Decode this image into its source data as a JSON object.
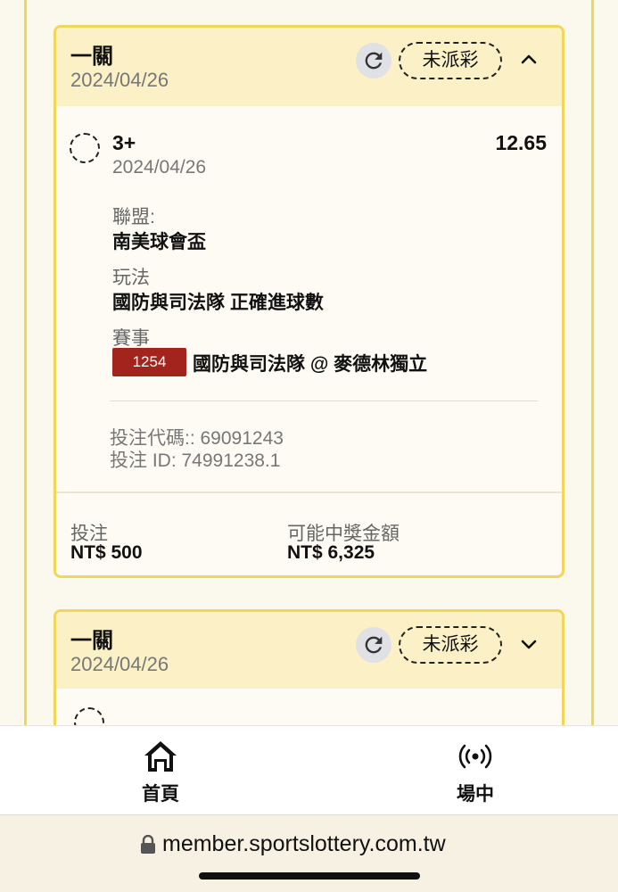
{
  "bets": [
    {
      "bet_type": "一關",
      "date": "2024/04/26",
      "status": "未派彩",
      "expanded": true,
      "selection": {
        "pick": "3+",
        "odds": "12.65",
        "date": "2024/04/26",
        "league_label": "聯盟:",
        "league": "南美球會盃",
        "market_label": "玩法",
        "market": "國防與司法隊 正確進球數",
        "match_label": "賽事",
        "match_id": "1254",
        "match": "國防與司法隊 @ 麥德林獨立"
      },
      "bet_code_line": "投注代碼:: 69091243",
      "bet_id_line": "投注 ID: 74991238.1",
      "stake_label": "投注",
      "stake": "NT$ 500",
      "payout_label": "可能中獎金額",
      "payout": "NT$ 6,325"
    },
    {
      "bet_type": "一關",
      "date": "2024/04/26",
      "status": "未派彩",
      "expanded": false
    }
  ],
  "tabbar": {
    "home_label": "首頁",
    "live_label": "場中"
  },
  "browser": {
    "url": "member.sportslottery.com.tw"
  },
  "colors": {
    "accent_border": "#f2d65a",
    "card_header": "#fbf0c6",
    "match_badge": "#a3241c"
  },
  "icons": [
    "refresh-icon",
    "chevron-up-icon",
    "chevron-down-icon",
    "home-icon",
    "live-broadcast-icon",
    "lock-icon"
  ]
}
